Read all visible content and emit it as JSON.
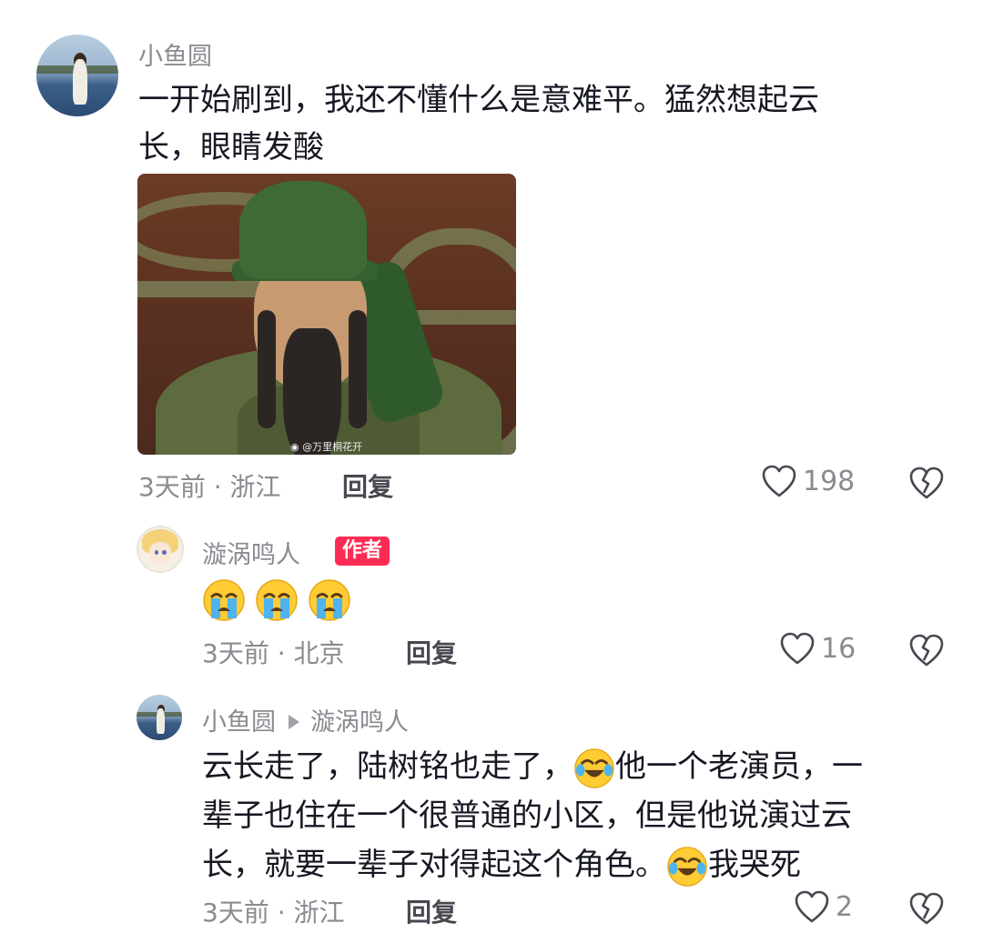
{
  "comments": [
    {
      "user": "小鱼圆",
      "text_lines": [
        "一开始刷到，我还不懂什么是意难平。猛然想起云",
        "长，眼睛发酸"
      ],
      "image_watermark": "@万里桐花开",
      "time_location": "3天前 · 浙江",
      "reply_label": "回复",
      "likes": "198",
      "avatar_icon": "lake-girl-avatar"
    },
    {
      "user": "漩涡鸣人",
      "badge": "作者",
      "emojis": [
        "crying-emoji",
        "crying-emoji",
        "crying-emoji"
      ],
      "time_location": "3天前 · 北京",
      "reply_label": "回复",
      "likes": "16",
      "avatar_icon": "anime-avatar"
    },
    {
      "user": "小鱼圆",
      "reply_to": "漩涡鸣人",
      "text_parts": {
        "line1a": "云长走了，陆树铭也走了，",
        "line1b": "他一个老演员，一",
        "line2": "辈子也住在一个很普通的小区，但是他说演过云",
        "line3a": "长，就要一辈子对得起这个角色。",
        "line3b": "我哭死"
      },
      "time_location": "3天前 · 浙江",
      "reply_label": "回复",
      "likes": "2",
      "avatar_icon": "lake-girl-avatar"
    }
  ],
  "colors": {
    "badge": "#fe2c55",
    "text": "#161823",
    "meta": "#8a8b91"
  }
}
